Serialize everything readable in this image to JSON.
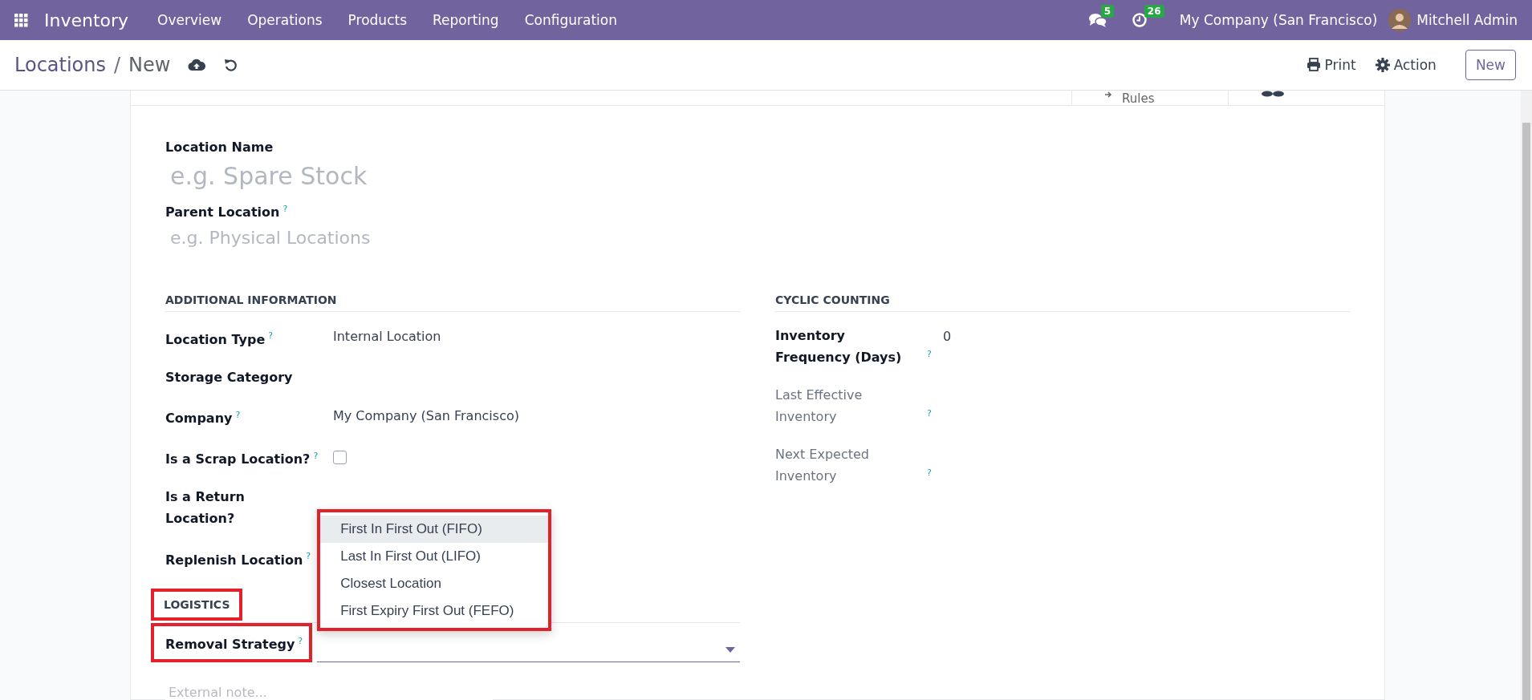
{
  "navbar": {
    "app_name": "Inventory",
    "menu": [
      "Overview",
      "Operations",
      "Products",
      "Reporting",
      "Configuration"
    ],
    "messages_count": "5",
    "activities_count": "26",
    "company": "My Company (San Francisco)",
    "user": "Mitchell Admin"
  },
  "control_panel": {
    "breadcrumbs": [
      {
        "label": "Locations",
        "kind": "link"
      },
      {
        "label": "New",
        "kind": "current"
      }
    ],
    "separator": "/",
    "actions": [
      {
        "label": "Print",
        "kind": "print"
      },
      {
        "label": "Action",
        "kind": "gear"
      }
    ],
    "new_button": "New"
  },
  "button_box": [
    {
      "kind": "arrow",
      "label": "Rules"
    },
    {
      "kind": "ovals"
    }
  ],
  "form": {
    "title_fields": [
      {
        "label": "Location Name",
        "placeholder": "e.g. Spare Stock"
      },
      {
        "label": "Parent Location",
        "help": "?",
        "placeholder": "e.g. Physical Locations"
      }
    ],
    "groups": [
      {
        "title": "ADDITIONAL INFORMATION",
        "fields": [
          {
            "label": "Location Type",
            "help": "?",
            "kind": "text",
            "value": "Internal Location"
          },
          {
            "label": "Storage Category",
            "kind": "empty"
          },
          {
            "label": "Company",
            "help": "?",
            "kind": "text",
            "value": "My Company (San Francisco)"
          },
          {
            "label": "Is a Scrap Location?",
            "help": "?",
            "kind": "checkbox",
            "checked": false
          },
          {
            "label": "Is a Return Location?",
            "kind": "empty"
          },
          {
            "label": "Replenish Location",
            "help": "?",
            "kind": "empty"
          }
        ]
      },
      {
        "title": "CYCLIC COUNTING",
        "fields": [
          {
            "label": "Inventory Frequency (Days)",
            "help": "?",
            "kind": "text",
            "value": "0"
          },
          {
            "label": "Last Effective Inventory",
            "help": "?",
            "kind": "empty",
            "muted": true
          },
          {
            "label": "Next Expected Inventory",
            "help": "?",
            "kind": "empty",
            "muted": true
          }
        ]
      }
    ],
    "logistics": {
      "title": "LOGISTICS",
      "highlighted": true,
      "field": {
        "label": "Removal Strategy",
        "help": "?",
        "highlighted": true,
        "open": true,
        "dropdown_highlighted": true,
        "options": [
          {
            "label": "First In First Out (FIFO)",
            "selected": true
          },
          {
            "label": "Last In First Out (LIFO)",
            "selected": false
          },
          {
            "label": "Closest Location",
            "selected": false
          },
          {
            "label": "First Expiry First Out (FEFO)",
            "selected": false
          }
        ]
      }
    },
    "note": {
      "placeholder": "External note..."
    }
  }
}
